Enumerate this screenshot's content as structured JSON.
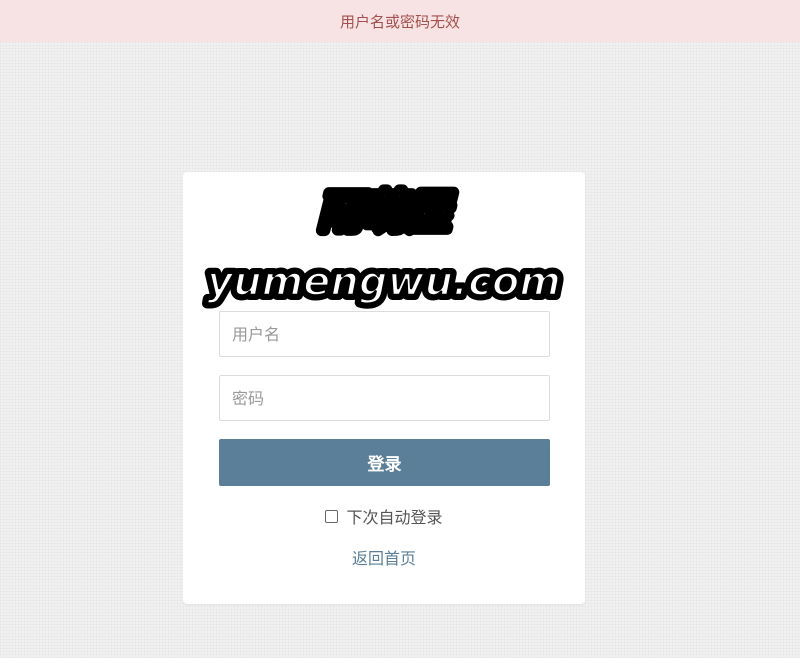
{
  "alert": {
    "message": "用户名或密码无效"
  },
  "logo": {
    "title": "雨萌屋",
    "domain": "yumengwu.com"
  },
  "form": {
    "username_placeholder": "用户名",
    "username_value": "",
    "password_placeholder": "密码",
    "password_value": "",
    "login_label": "登录",
    "remember_label": "下次自动登录",
    "remember_checked": false,
    "back_home_label": "返回首页"
  },
  "colors": {
    "alert_bg": "#f7e3e3",
    "alert_text": "#a4504e",
    "accent": "#5b7f98"
  }
}
